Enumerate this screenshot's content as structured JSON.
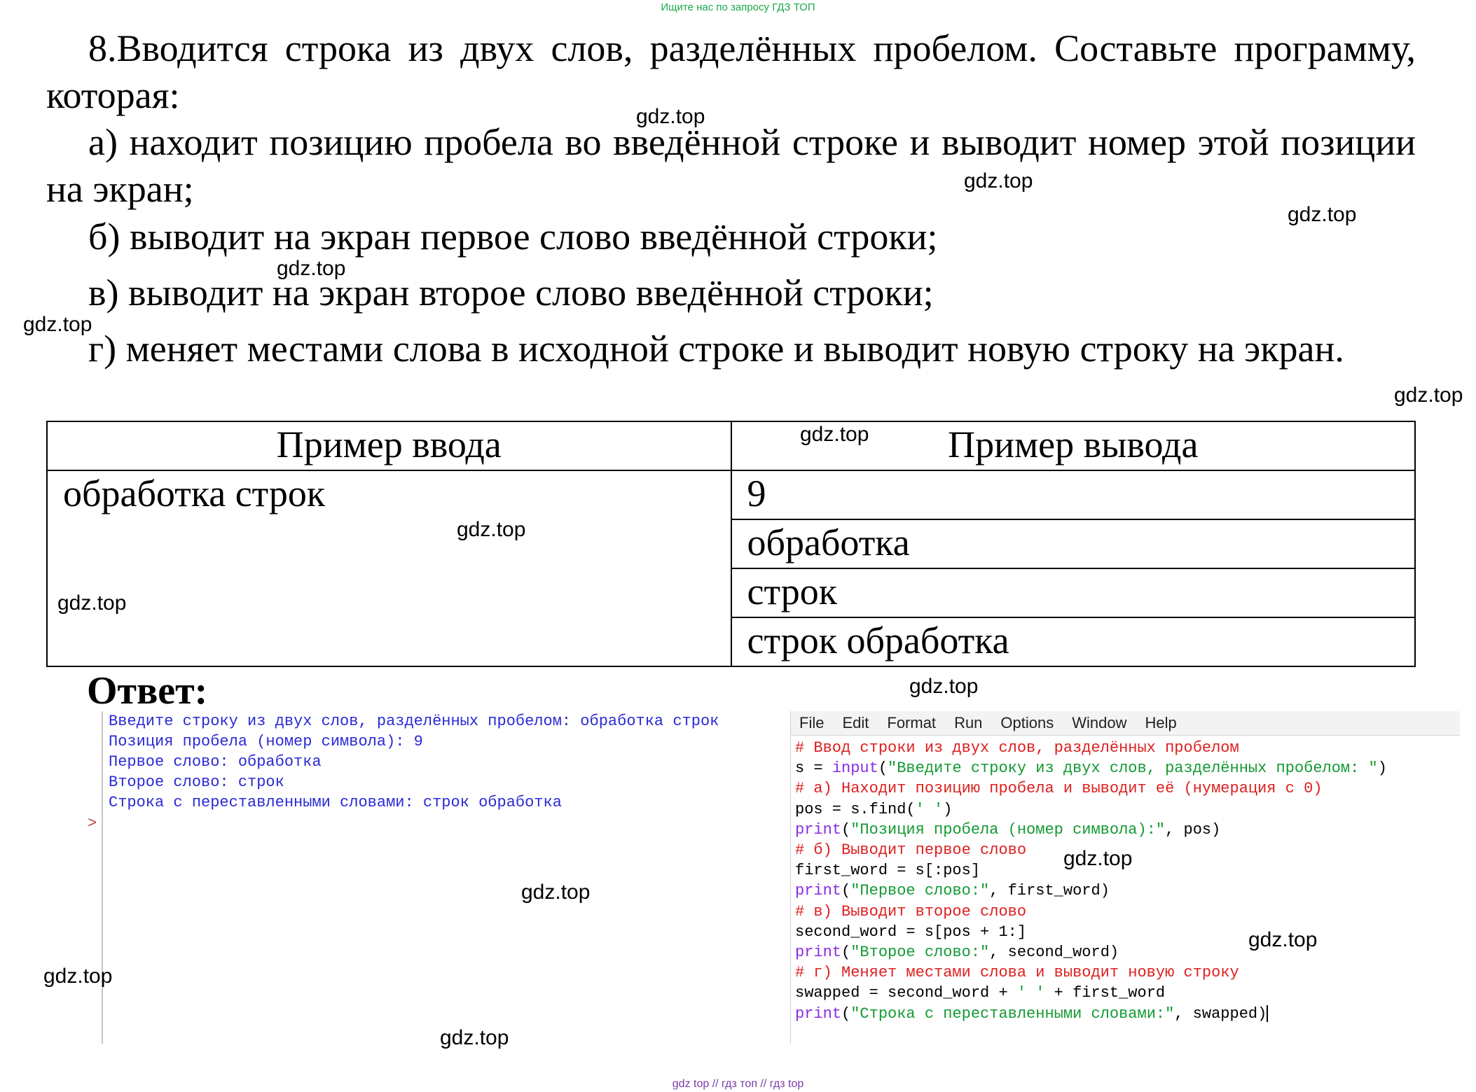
{
  "header_link": "Ищите нас по запросу ГДЗ ТОП",
  "task": {
    "intro": "8.Вводится строка из двух слов, разделённых пробелом. Составьте программу, которая:",
    "item_a": "а) находит позицию пробела во введённой строке и выводит номер этой позиции на экран;",
    "item_b": "б) выводит на экран первое слово введённой строки;",
    "item_v": "в) выводит на экран второе слово введённой строки;",
    "item_g": "г) меняет местами слова в исходной строке и выводит новую строку на экран."
  },
  "table": {
    "header_input": "Пример ввода",
    "header_output": "Пример вывода",
    "input_value": "обработка строк",
    "outputs": [
      "9",
      "обработка",
      "строк",
      "строк обработка"
    ]
  },
  "answer_title": "Ответ:",
  "shell": {
    "lines": [
      "Введите строку из двух слов, разделённых пробелом: обработка строк",
      "Позиция пробела (номер символа): 9",
      "Первое слово: обработка",
      "Второе слово: строк",
      "Строка с переставленными словами: строк обработка"
    ],
    "prompt": ">"
  },
  "editor": {
    "menu": [
      "File",
      "Edit",
      "Format",
      "Run",
      "Options",
      "Window",
      "Help"
    ],
    "code": {
      "c1": "# Ввод строки из двух слов, разделённых пробелом",
      "l2a": "s = ",
      "l2kw": "input",
      "l2b": "(",
      "l2str": "\"Введите строку из двух слов, разделённых пробелом: \"",
      "l2c": ")",
      "c3": "# а) Находит позицию пробела и выводит её (нумерация с 0)",
      "l4a": "pos = s.find(",
      "l4str": "' '",
      "l4b": ")",
      "l5kw": "print",
      "l5a": "(",
      "l5str": "\"Позиция пробела (номер символа):\"",
      "l5b": ", pos)",
      "c6": "# б) Выводит первое слово",
      "l7": "first_word = s[:pos]",
      "l8kw": "print",
      "l8a": "(",
      "l8str": "\"Первое слово:\"",
      "l8b": ", first_word)",
      "c9": "# в) Выводит второе слово",
      "l10": "second_word = s[pos + 1:]",
      "l11kw": "print",
      "l11a": "(",
      "l11str": "\"Второе слово:\"",
      "l11b": ", second_word)",
      "c12": "# г) Меняет местами слова и выводит новую строку",
      "l13a": "swapped = second_word + ",
      "l13str": "' '",
      "l13b": " + first_word",
      "l14kw": "print",
      "l14a": "(",
      "l14str": "\"Строка с переставленными словами:\"",
      "l14b": ", swapped)"
    }
  },
  "watermark": "gdz.top",
  "footer_links": "gdz top // гдз топ // гдз top"
}
